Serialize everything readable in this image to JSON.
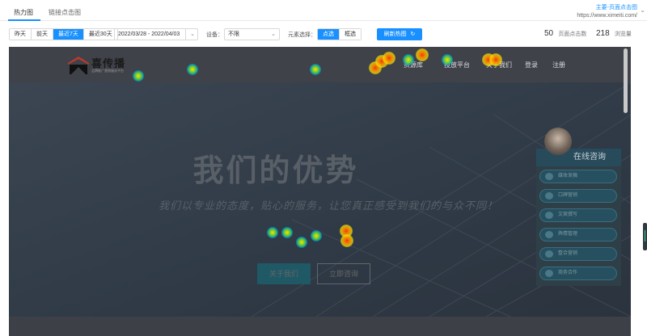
{
  "tabs": [
    {
      "label": "热力图",
      "active": true
    },
    {
      "label": "链接点击图",
      "active": false
    }
  ],
  "page_select": {
    "name": "主要-页面点击图",
    "url": "https://www.ximeiti.com/"
  },
  "filters": {
    "date_presets": [
      "昨天",
      "前天",
      "最近7天",
      "最近30天"
    ],
    "active_preset": "最近7天",
    "date_range": "2022/03/28 - 2022/04/03",
    "device_label": "设备：",
    "device_value": "不限",
    "element_label": "元素选择：",
    "element_options": [
      "点选",
      "框选"
    ],
    "active_element_option": "点选",
    "refresh_label": "刷新热图"
  },
  "stats": [
    {
      "value": "50",
      "unit": "页面点击数"
    },
    {
      "value": "218",
      "unit": "浏览量"
    }
  ],
  "site": {
    "logo_text": "喜传播",
    "logo_sub": "品牌推广营销服务平台",
    "nav": [
      "资源库",
      "投放平台",
      "关于我们",
      "登录",
      "注册"
    ],
    "hero_title": "我们的优势",
    "hero_subtitle": "我们以专业的态度，贴心的服务，让您真正感受到我们的与众不同！",
    "hero_buttons": [
      "关于我们",
      "立即咨询"
    ]
  },
  "consult": {
    "title": "在线咨询",
    "items": [
      "媒体发稿",
      "口碑营销",
      "文案撰写",
      "舆情管理",
      "整合营销",
      "商务合作"
    ]
  },
  "colors": {
    "accent": "#1890ff",
    "frame_bg": "#3a3d45"
  }
}
